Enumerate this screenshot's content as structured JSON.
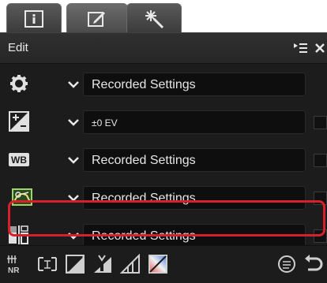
{
  "tabs": [
    {
      "name": "info",
      "icon": "info-icon"
    },
    {
      "name": "edit",
      "icon": "edit-icon"
    },
    {
      "name": "retouch",
      "icon": "sparkle-icon"
    }
  ],
  "header": {
    "title": "Edit",
    "icons": [
      "panel-menu-icon",
      "close-icon"
    ]
  },
  "rows": [
    {
      "icon": "gear-icon",
      "value": "Recorded Settings"
    },
    {
      "icon": "exposure-icon",
      "value": "±0 EV"
    },
    {
      "icon": "wb-icon",
      "badge": "WB",
      "value": "Recorded Settings"
    },
    {
      "icon": "picture-control-icon",
      "value": "Recorded Settings",
      "highlighted": true
    },
    {
      "icon": "color-space-icon",
      "value": "Recorded Settings"
    }
  ],
  "toolbar": [
    "noise-reduction-icon",
    "crop-icon",
    "levels-curves-icon",
    "color-booster-icon",
    "perspective-icon",
    "color-balance-icon",
    "reset-icon",
    "undo-icon"
  ],
  "colors": {
    "highlight": "#d8202a",
    "panel": "#1c1c1c",
    "field": "#0e0e0e"
  }
}
